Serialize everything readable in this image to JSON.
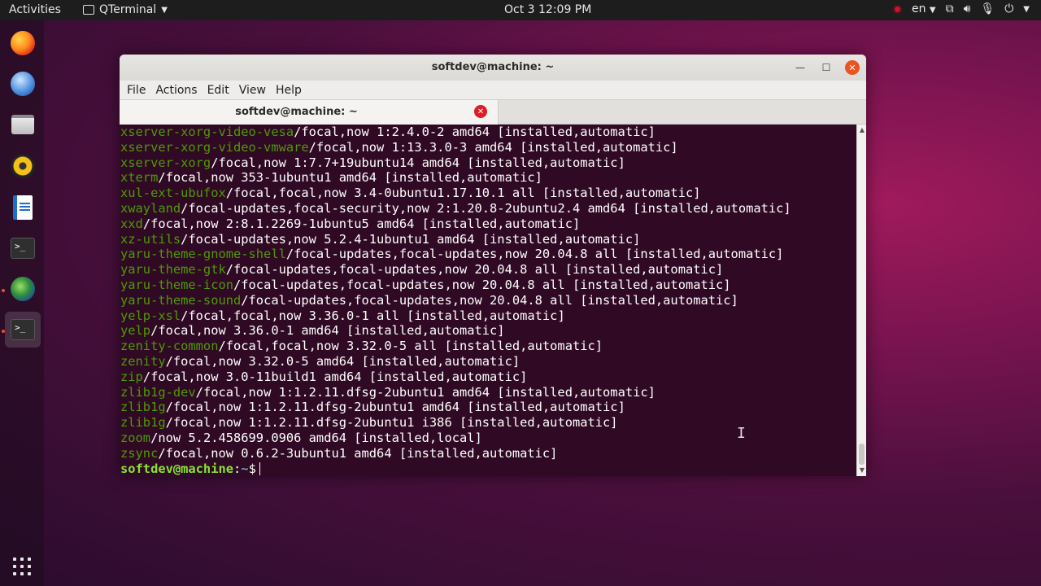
{
  "topbar": {
    "activities": "Activities",
    "app_name": "QTerminal",
    "clock": "Oct 3  12:09 PM",
    "language": "en"
  },
  "dock": {
    "items": [
      "firefox-icon",
      "thunderbird-icon",
      "files-icon",
      "rhythmbox-icon",
      "libreoffice-writer-icon",
      "terminal-icon",
      "globe-browser-icon",
      "qterminal-icon",
      "show-applications-icon"
    ]
  },
  "window": {
    "title": "softdev@machine: ~",
    "menu": [
      "File",
      "Actions",
      "Edit",
      "View",
      "Help"
    ],
    "tab_title": "softdev@machine: ~"
  },
  "terminal": {
    "lines": [
      {
        "pkg": "xserver-xorg-video-vesa",
        "rest": "/focal,now 1:2.4.0-2 amd64 [installed,automatic]"
      },
      {
        "pkg": "xserver-xorg-video-vmware",
        "rest": "/focal,now 1:13.3.0-3 amd64 [installed,automatic]"
      },
      {
        "pkg": "xserver-xorg",
        "rest": "/focal,now 1:7.7+19ubuntu14 amd64 [installed,automatic]"
      },
      {
        "pkg": "xterm",
        "rest": "/focal,now 353-1ubuntu1 amd64 [installed,automatic]"
      },
      {
        "pkg": "xul-ext-ubufox",
        "rest": "/focal,focal,now 3.4-0ubuntu1.17.10.1 all [installed,automatic]"
      },
      {
        "pkg": "xwayland",
        "rest": "/focal-updates,focal-security,now 2:1.20.8-2ubuntu2.4 amd64 [installed,automatic]"
      },
      {
        "pkg": "xxd",
        "rest": "/focal,now 2:8.1.2269-1ubuntu5 amd64 [installed,automatic]"
      },
      {
        "pkg": "xz-utils",
        "rest": "/focal-updates,now 5.2.4-1ubuntu1 amd64 [installed,automatic]"
      },
      {
        "pkg": "yaru-theme-gnome-shell",
        "rest": "/focal-updates,focal-updates,now 20.04.8 all [installed,automatic]"
      },
      {
        "pkg": "yaru-theme-gtk",
        "rest": "/focal-updates,focal-updates,now 20.04.8 all [installed,automatic]"
      },
      {
        "pkg": "yaru-theme-icon",
        "rest": "/focal-updates,focal-updates,now 20.04.8 all [installed,automatic]"
      },
      {
        "pkg": "yaru-theme-sound",
        "rest": "/focal-updates,focal-updates,now 20.04.8 all [installed,automatic]"
      },
      {
        "pkg": "yelp-xsl",
        "rest": "/focal,focal,now 3.36.0-1 all [installed,automatic]"
      },
      {
        "pkg": "yelp",
        "rest": "/focal,now 3.36.0-1 amd64 [installed,automatic]"
      },
      {
        "pkg": "zenity-common",
        "rest": "/focal,focal,now 3.32.0-5 all [installed,automatic]"
      },
      {
        "pkg": "zenity",
        "rest": "/focal,now 3.32.0-5 amd64 [installed,automatic]"
      },
      {
        "pkg": "zip",
        "rest": "/focal,now 3.0-11build1 amd64 [installed,automatic]"
      },
      {
        "pkg": "zlib1g-dev",
        "rest": "/focal,now 1:1.2.11.dfsg-2ubuntu1 amd64 [installed,automatic]"
      },
      {
        "pkg": "zlib1g",
        "rest": "/focal,now 1:1.2.11.dfsg-2ubuntu1 amd64 [installed,automatic]"
      },
      {
        "pkg": "zlib1g",
        "rest": "/focal,now 1:1.2.11.dfsg-2ubuntu1 i386 [installed,automatic]"
      },
      {
        "pkg": "zoom",
        "rest": "/now 5.2.458699.0906 amd64 [installed,local]"
      },
      {
        "pkg": "zsync",
        "rest": "/focal,now 0.6.2-3ubuntu1 amd64 [installed,automatic]"
      }
    ],
    "prompt_user": "softdev@machine",
    "prompt_sep": ":",
    "prompt_path": "~",
    "prompt_symbol": "$"
  }
}
